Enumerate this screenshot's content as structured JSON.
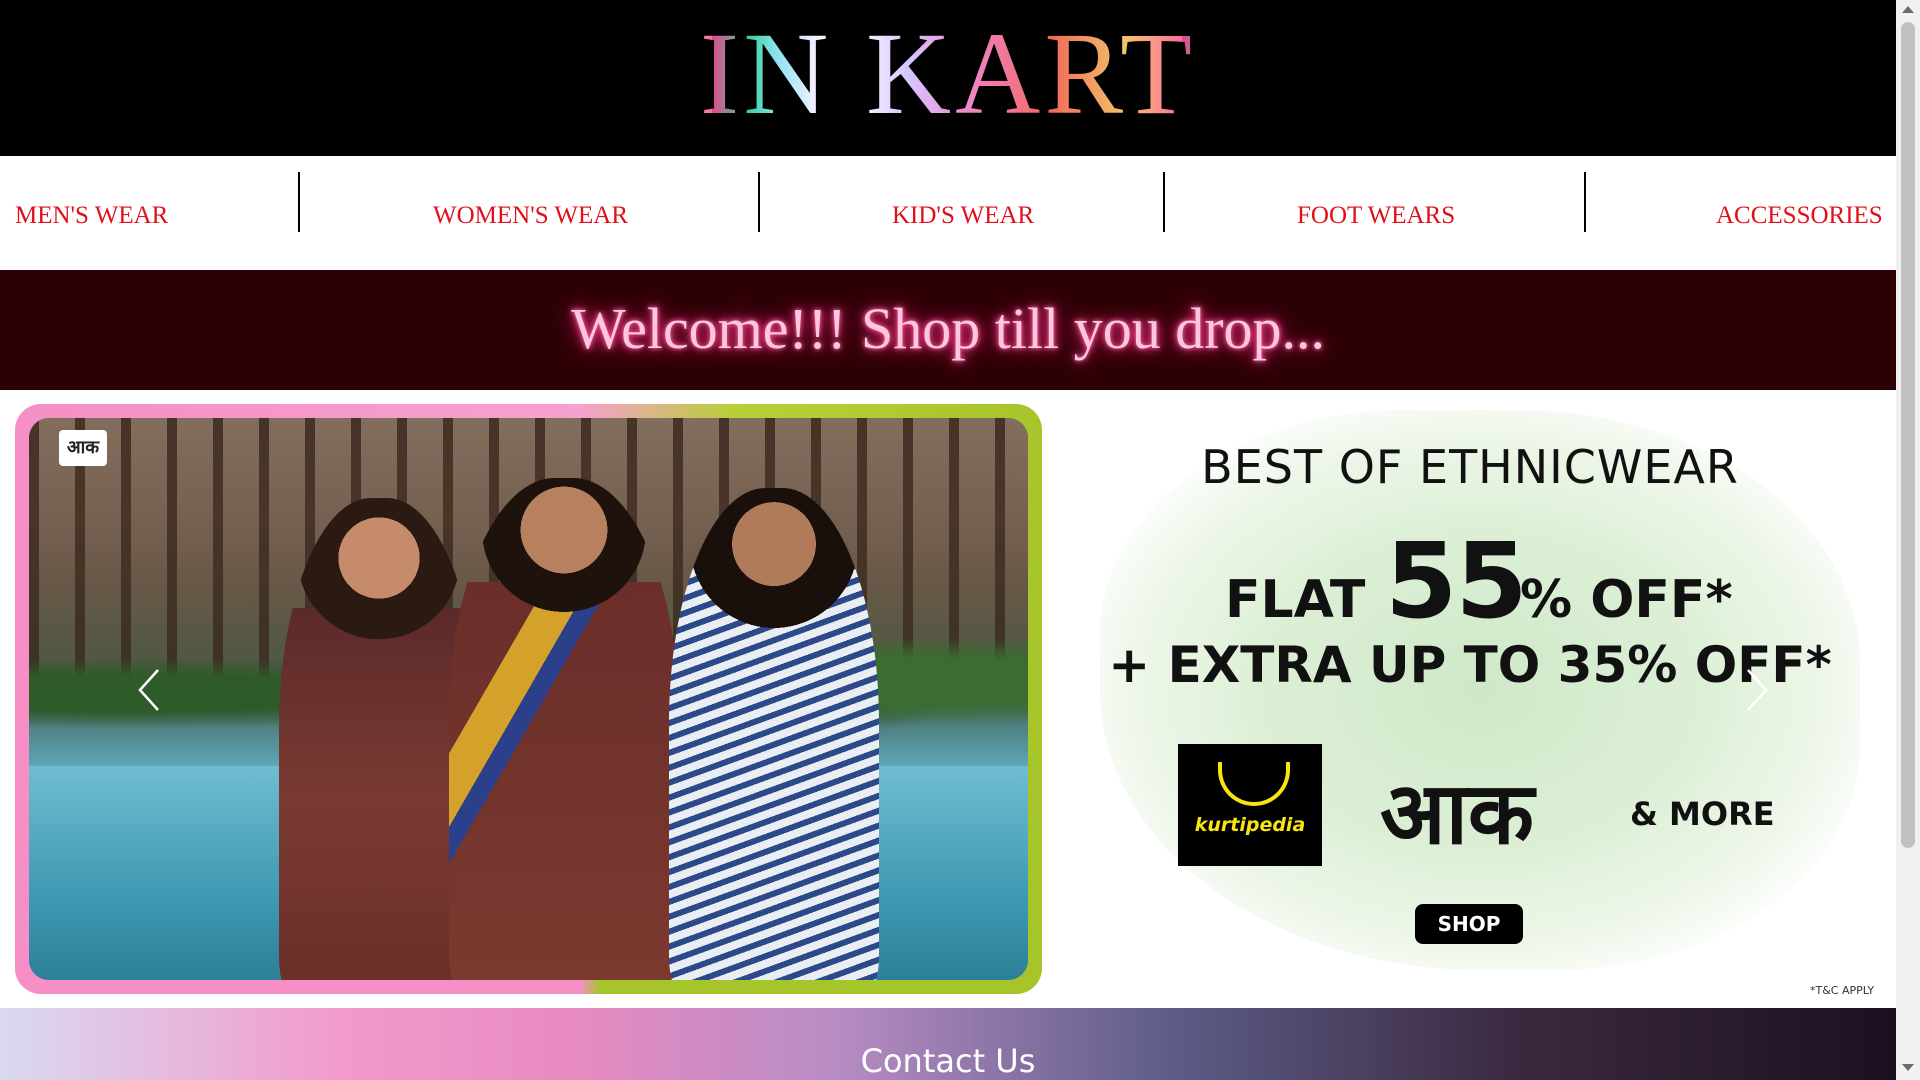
{
  "header": {
    "logo": "IN KART"
  },
  "nav": {
    "items": [
      {
        "label": "MEN'S WEAR"
      },
      {
        "label": "WOMEN'S WEAR"
      },
      {
        "label": "KID'S WEAR"
      },
      {
        "label": "FOOT WEARS"
      },
      {
        "label": "ACCESSORIES"
      }
    ],
    "color": "#e0101a"
  },
  "welcome": {
    "text": "Welcome!!! Shop till you drop..."
  },
  "carousel": {
    "slide": {
      "badge": "आक",
      "title": "BEST OF ETHNICWEAR",
      "flat": "FLAT",
      "percent": "55",
      "off": "% OFF*",
      "extra": "+ EXTRA UP TO 35% OFF*",
      "brand1": "kurtipedia",
      "brand2": "आक",
      "more": "& MORE",
      "shop": "SHOP",
      "terms": "*T&C APPLY"
    },
    "prev_icon": "chevron-left-icon",
    "next_icon": "chevron-right-icon"
  },
  "contact": {
    "title": "Contact Us"
  },
  "colors": {
    "header_bg": "#000000",
    "welcome_bg": "#2d0006",
    "nav_text": "#e0101a"
  }
}
